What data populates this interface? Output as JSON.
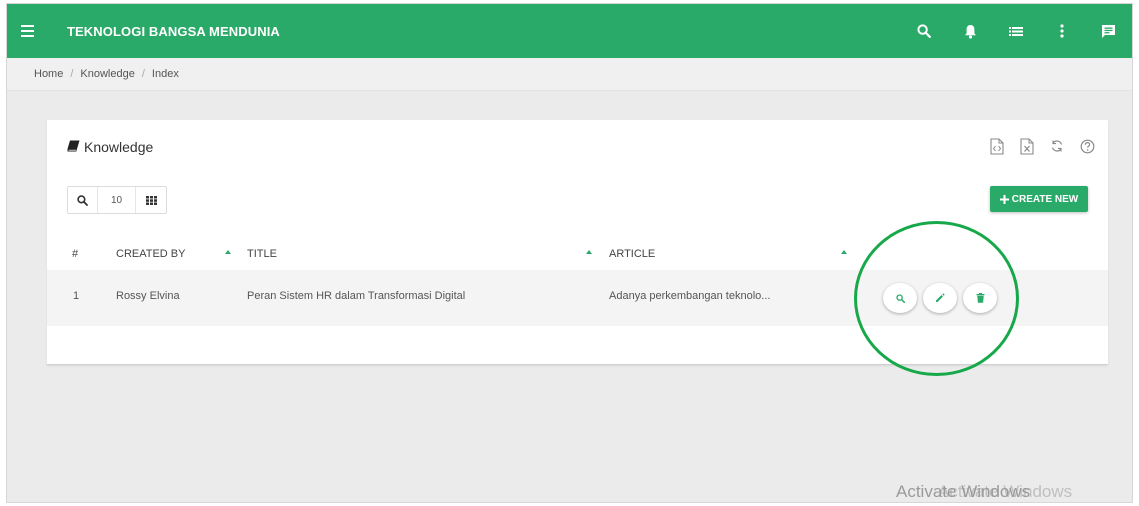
{
  "app": {
    "title": "TEKNOLOGI BANGSA MENDUNIA"
  },
  "topbar": {
    "icons": [
      "search-icon",
      "bell-icon",
      "list-icon",
      "more-vert-icon",
      "chat-icon"
    ]
  },
  "breadcrumb": {
    "items": [
      "Home",
      "Knowledge",
      "Index"
    ],
    "separator": "/"
  },
  "card": {
    "title": "Knowledge",
    "title_icon": "book-icon",
    "tools": [
      "csv-export-icon",
      "excel-export-icon",
      "refresh-icon",
      "help-icon"
    ],
    "toolbar": {
      "page_size": "10"
    },
    "create_button": {
      "label": "CREATE NEW",
      "icon": "plus-icon"
    }
  },
  "table": {
    "columns": [
      "#",
      "CREATED BY",
      "TITLE",
      "ARTICLE"
    ],
    "rows": [
      {
        "no": "1",
        "created_by": "Rossy Elvina",
        "title": "Peran Sistem HR dalam Transformasi Digital",
        "article": "Adanya perkembangan teknolo..."
      }
    ],
    "row_actions": [
      "view-icon",
      "edit-icon",
      "delete-icon"
    ]
  },
  "watermark": {
    "text": "Activate Windows"
  },
  "colors": {
    "primary": "#2aaa68",
    "highlight": "#17a84a"
  }
}
